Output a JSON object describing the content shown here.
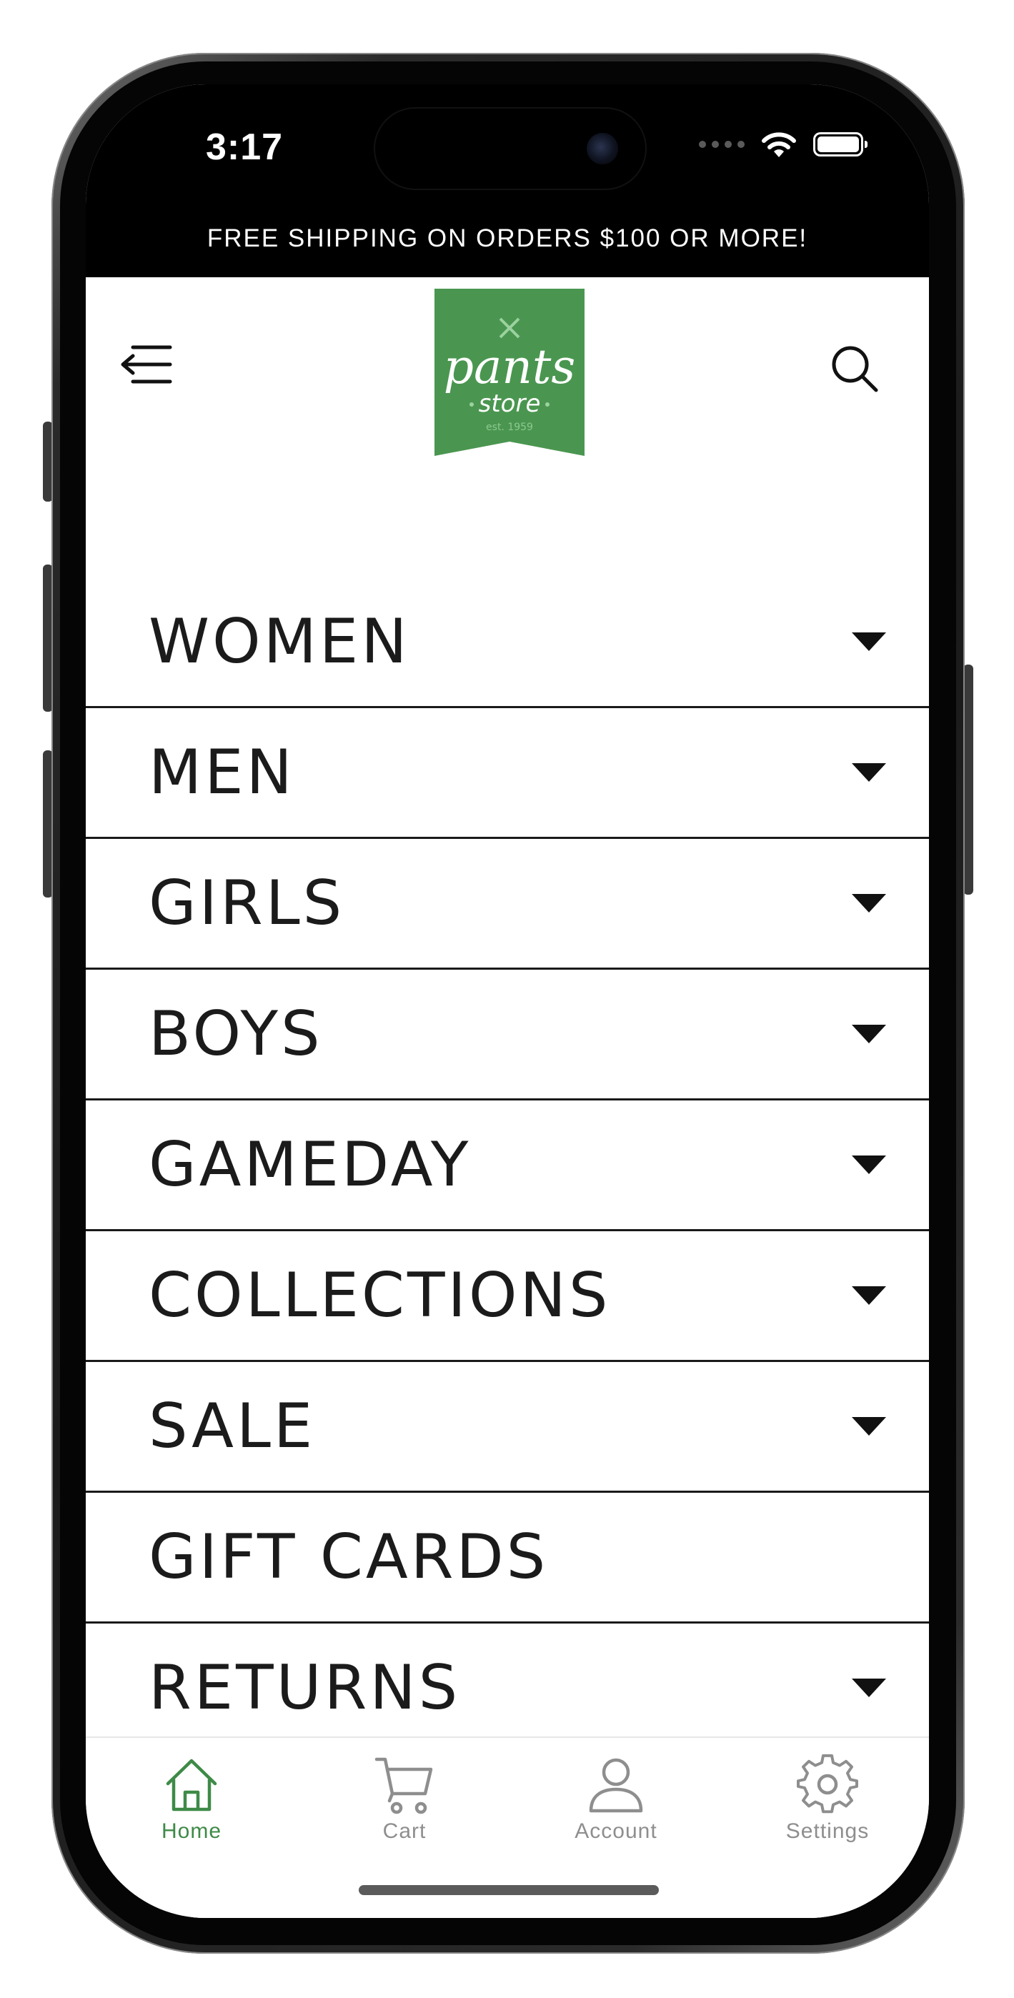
{
  "status_bar": {
    "time": "3:17"
  },
  "banner": {
    "text": "FREE SHIPPING ON ORDERS $100 OR MORE!"
  },
  "logo": {
    "main": "pants",
    "sub": "store",
    "est": "est. 1959",
    "color": "#4a9650"
  },
  "menu": {
    "items": [
      {
        "label": "WOMEN",
        "expandable": true
      },
      {
        "label": "MEN",
        "expandable": true
      },
      {
        "label": "GIRLS",
        "expandable": true
      },
      {
        "label": "BOYS",
        "expandable": true
      },
      {
        "label": "GAMEDAY",
        "expandable": true
      },
      {
        "label": "COLLECTIONS",
        "expandable": true
      },
      {
        "label": "SALE",
        "expandable": true
      },
      {
        "label": "GIFT CARDS",
        "expandable": false
      },
      {
        "label": "RETURNS",
        "expandable": true
      }
    ]
  },
  "tabbar": {
    "active_color": "#3e8a47",
    "inactive_color": "#8e8e8e",
    "tabs": [
      {
        "label": "Home",
        "icon": "home-icon",
        "active": true
      },
      {
        "label": "Cart",
        "icon": "cart-icon",
        "active": false
      },
      {
        "label": "Account",
        "icon": "person-icon",
        "active": false
      },
      {
        "label": "Settings",
        "icon": "gear-icon",
        "active": false
      }
    ]
  }
}
